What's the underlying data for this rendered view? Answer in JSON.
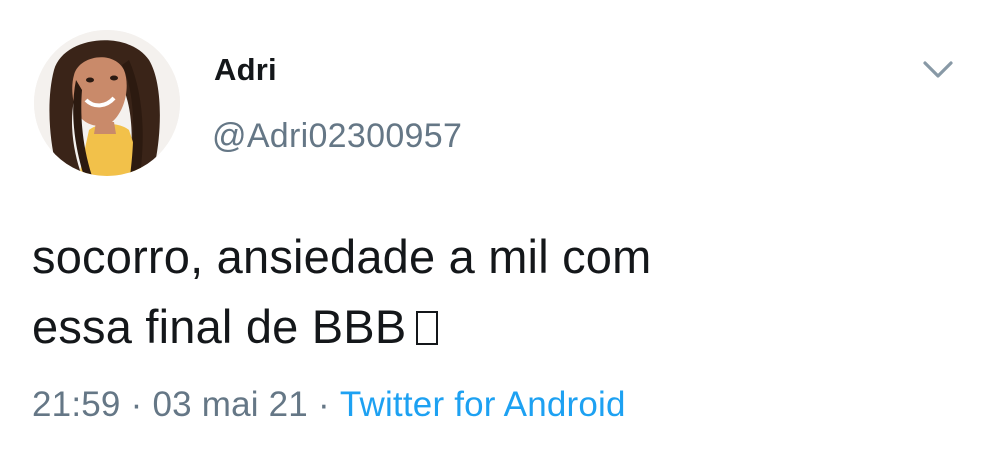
{
  "tweet": {
    "author": {
      "display_name": "Adri",
      "handle": "@Adri02300957",
      "avatar_icon": "profile-photo"
    },
    "menu_icon": "chevron-down-icon",
    "text_lines": [
      "socorro, ansiedade a mil com",
      "essa final de BBB"
    ],
    "emoji_icon": "missing-glyph-box",
    "time": "21:59",
    "date": "03 mai 21",
    "separator": "·",
    "source": "Twitter for Android"
  },
  "colors": {
    "text": "#14171a",
    "secondary": "#657786",
    "link": "#1da1f2"
  }
}
